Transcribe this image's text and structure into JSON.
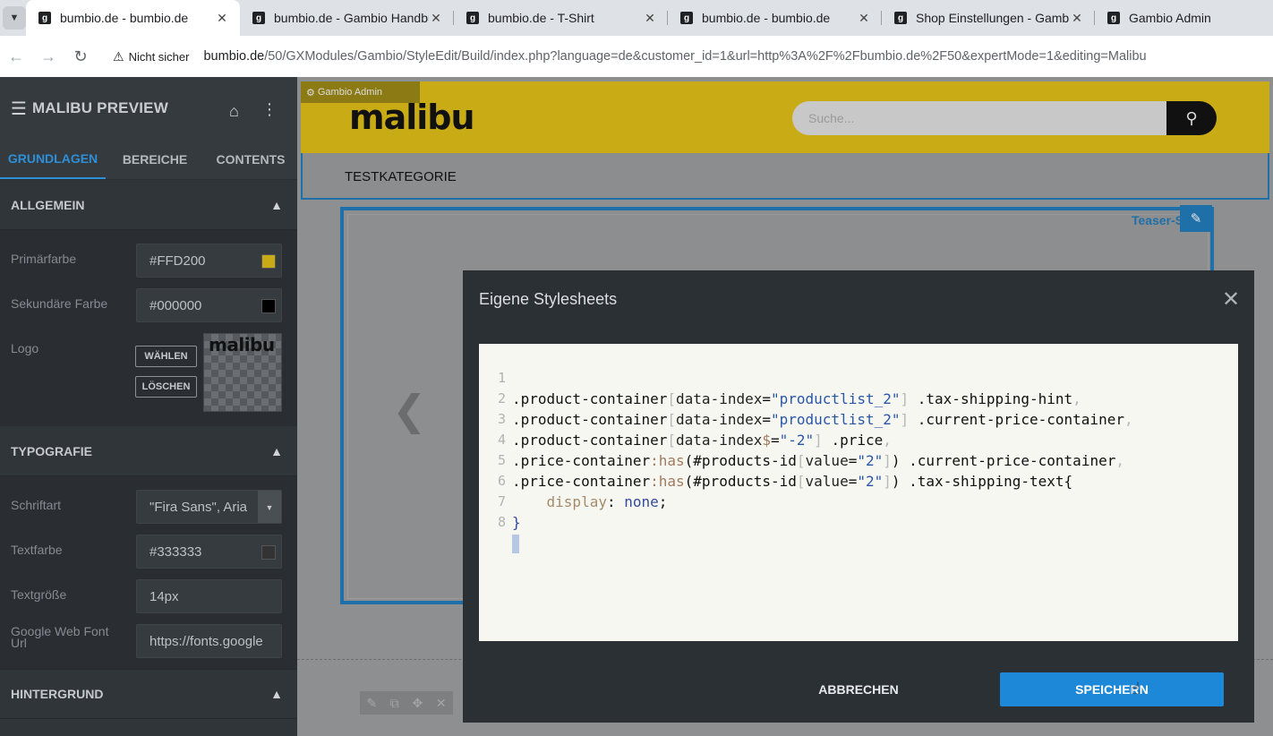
{
  "browser": {
    "tabs": [
      {
        "title": "bumbio.de - bumbio.de"
      },
      {
        "title": "bumbio.de - Gambio Handbuch"
      },
      {
        "title": "bumbio.de - T-Shirt"
      },
      {
        "title": "bumbio.de - bumbio.de"
      },
      {
        "title": "Shop Einstellungen - Gambio Admin"
      },
      {
        "title": "Gambio Admin"
      }
    ],
    "security_label": "Nicht sicher",
    "url_host": "bumbio.de",
    "url_path": "/50/GXModules/Gambio/StyleEdit/Build/index.php?language=de&customer_id=1&url=http%3A%2F%2Fbumbio.de%2F50&expertMode=1&editing=Malibu"
  },
  "sidebar": {
    "title": "MALIBU PREVIEW",
    "tabs": [
      "GRUNDLAGEN",
      "BEREICHE",
      "CONTENTS"
    ],
    "sections": {
      "allgemein": {
        "title": "ALLGEMEIN",
        "primary_label": "Primärfarbe",
        "primary_value": "#FFD200",
        "primary_color": "#c9ab15",
        "secondary_label": "Sekundäre Farbe",
        "secondary_value": "#000000",
        "secondary_color": "#000000",
        "logo_label": "Logo",
        "choose_btn": "WÄHLEN",
        "delete_btn": "LÖSCHEN",
        "logo_text": "malibu"
      },
      "typografie": {
        "title": "TYPOGRAFIE",
        "font_label": "Schriftart",
        "font_value": "\"Fira Sans\", Aria",
        "color_label": "Textfarbe",
        "color_value": "#333333",
        "size_label": "Textgröße",
        "size_value": "14px",
        "webfont_label": "Google Web Font Url",
        "webfont_value": "https://fonts.google"
      },
      "hintergrund": {
        "title": "HINTERGRUND"
      }
    }
  },
  "preview": {
    "admin_badge": "Gambio Admin",
    "logo_text": "malibu",
    "search_placeholder": "Suche...",
    "nav_category": "TESTKATEGORIE",
    "teaser_label": "Teaser-Slider"
  },
  "modal": {
    "title": "Eigene Stylesheets",
    "cancel_label": "ABBRECHEN",
    "save_label": "SPEICHERN",
    "line_numbers": [
      "1",
      "2",
      "3",
      "4",
      "5",
      "6",
      "7",
      "8"
    ]
  }
}
